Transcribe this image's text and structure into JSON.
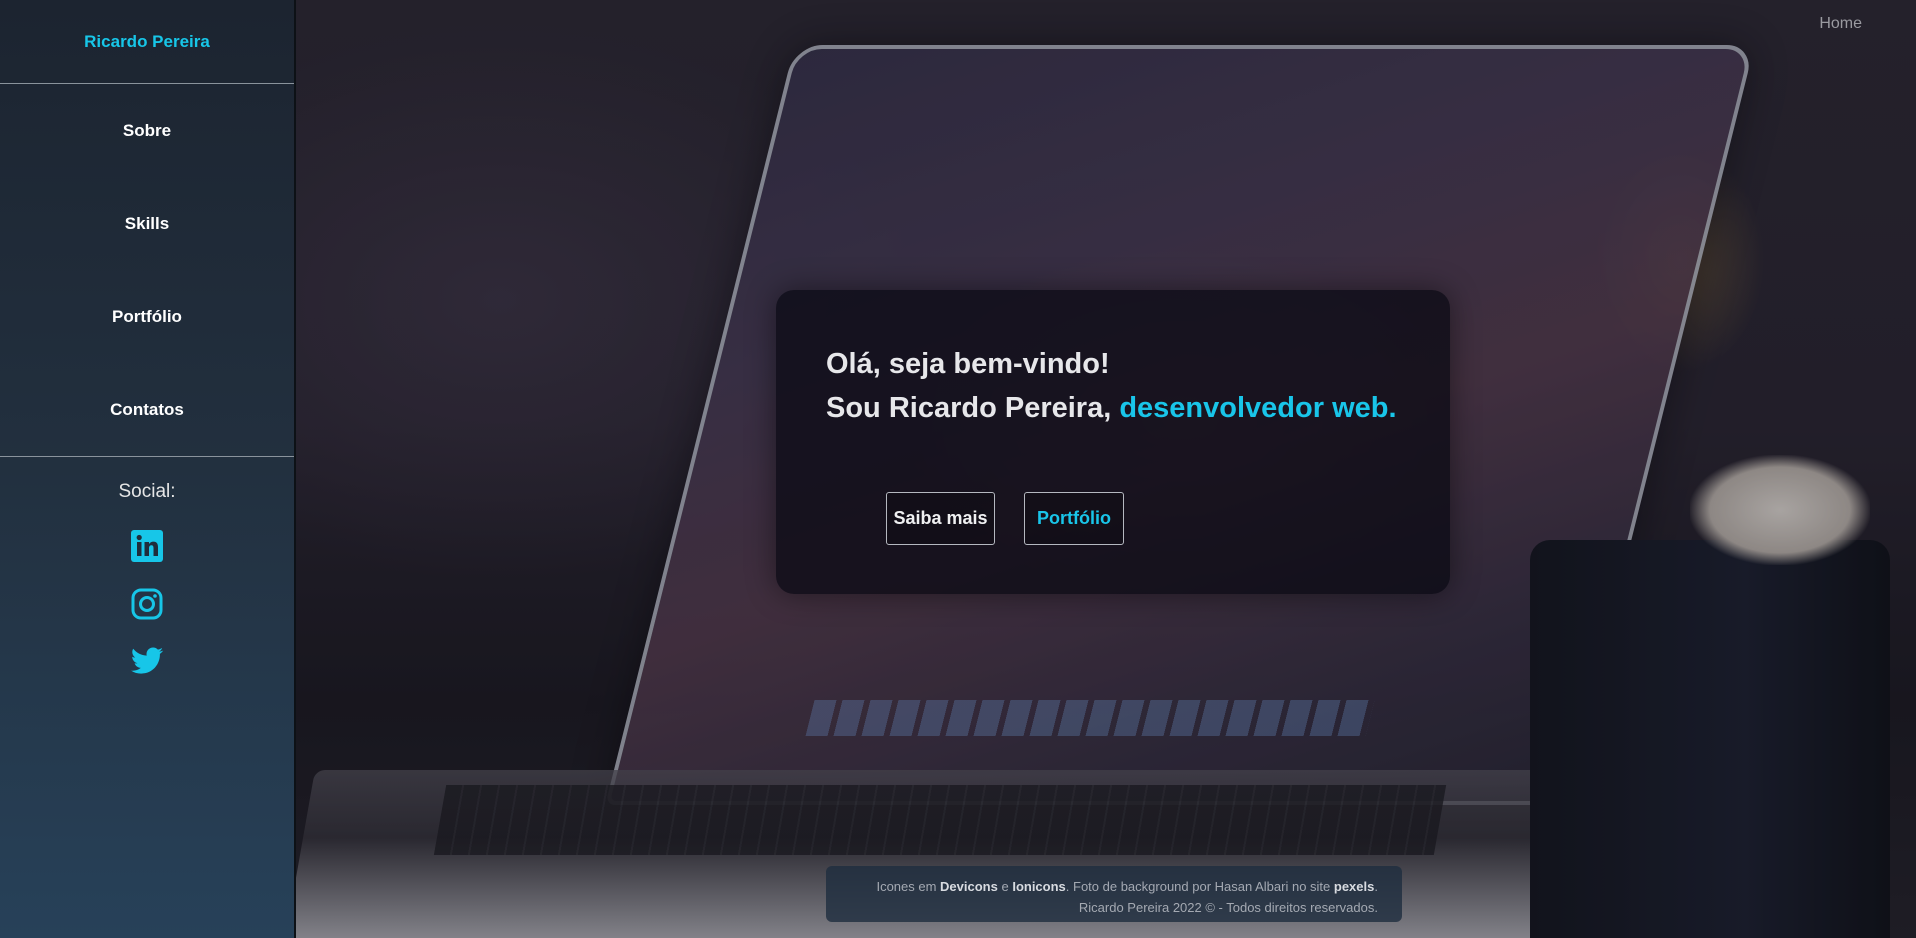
{
  "sidebar": {
    "brand": "Ricardo Pereira",
    "nav": [
      "Sobre",
      "Skills",
      "Portfólio",
      "Contatos"
    ],
    "social_label": "Social:",
    "social_icons": [
      "linkedin-icon",
      "instagram-icon",
      "twitter-icon"
    ]
  },
  "topnav": {
    "home": "Home"
  },
  "hero": {
    "line1": "Olá, seja bem-vindo!",
    "line2_prefix": "Sou Ricardo Pereira, ",
    "line2_accent": "desenvolvedor web.",
    "btn_more": "Saiba mais",
    "btn_portfolio": "Portfólio"
  },
  "footer": {
    "t1": "Icones em ",
    "devicons": "Devicons",
    "t2": " e ",
    "ionicons": "Ionicons",
    "t3": ". Foto de background por Hasan Albari no site ",
    "pexels": "pexels",
    "t4": ".",
    "line2": "Ricardo Pereira 2022 © - Todos direitos reservados."
  },
  "colors": {
    "accent": "#19c5e9",
    "sidebar_top": "#1c2430",
    "sidebar_bottom": "#274159"
  }
}
